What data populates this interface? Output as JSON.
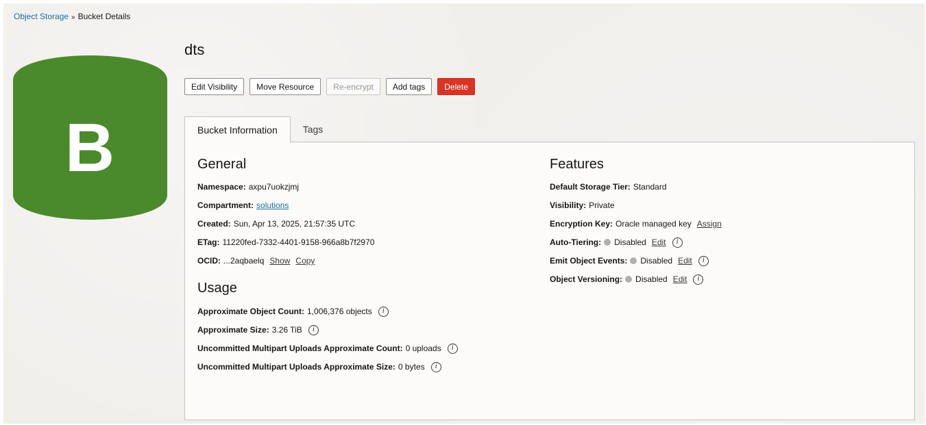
{
  "breadcrumb": {
    "parent": "Object Storage",
    "separator": "»",
    "current": "Bucket Details"
  },
  "bucket": {
    "icon_letter": "B",
    "icon_color": "#4b8a2c",
    "name": "dts"
  },
  "actions": {
    "edit_visibility": "Edit Visibility",
    "move_resource": "Move Resource",
    "re_encrypt": "Re-encrypt",
    "add_tags": "Add tags",
    "delete": "Delete"
  },
  "tabs": [
    {
      "label": "Bucket Information",
      "active": true
    },
    {
      "label": "Tags",
      "active": false
    }
  ],
  "general": {
    "title": "General",
    "namespace": {
      "label": "Namespace:",
      "value": "axpu7uokzjmj"
    },
    "compartment": {
      "label": "Compartment:",
      "value": "solutions"
    },
    "created": {
      "label": "Created:",
      "value": "Sun, Apr 13, 2025, 21:57:35 UTC"
    },
    "etag": {
      "label": "ETag:",
      "value": "11220fed-7332-4401-9158-966a8b7f2970"
    },
    "ocid": {
      "label": "OCID:",
      "value": "...2aqbaelq",
      "show": "Show",
      "copy": "Copy"
    }
  },
  "usage": {
    "title": "Usage",
    "object_count": {
      "label": "Approximate Object Count:",
      "value": "1,006,376 objects"
    },
    "size": {
      "label": "Approximate Size:",
      "value": "3.26 TiB"
    },
    "multipart_count": {
      "label": "Uncommitted Multipart Uploads Approximate Count:",
      "value": "0 uploads"
    },
    "multipart_size": {
      "label": "Uncommitted Multipart Uploads Approximate Size:",
      "value": "0 bytes"
    }
  },
  "features": {
    "title": "Features",
    "storage_tier": {
      "label": "Default Storage Tier:",
      "value": "Standard"
    },
    "visibility": {
      "label": "Visibility:",
      "value": "Private"
    },
    "encryption_key": {
      "label": "Encryption Key:",
      "value": "Oracle managed key",
      "action": "Assign"
    },
    "auto_tiering": {
      "label": "Auto-Tiering:",
      "value": "Disabled",
      "action": "Edit"
    },
    "emit_events": {
      "label": "Emit Object Events:",
      "value": "Disabled",
      "action": "Edit"
    },
    "versioning": {
      "label": "Object Versioning:",
      "value": "Disabled",
      "action": "Edit"
    }
  },
  "info_icon_glyph": "i",
  "colors": {
    "link": "#1c6fa3",
    "delete": "#d73527",
    "status_dot": "#b2b0ac"
  }
}
